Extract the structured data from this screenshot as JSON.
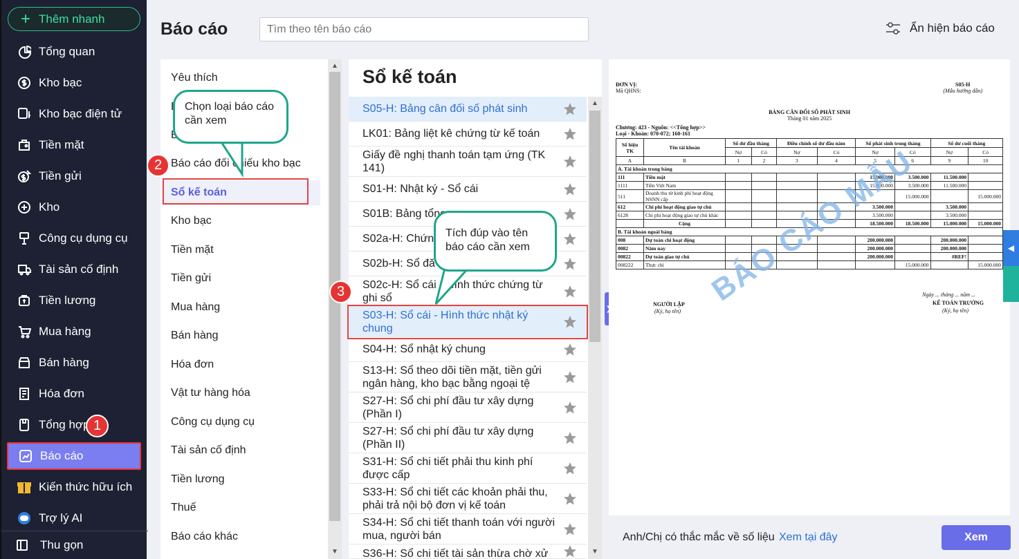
{
  "sidebar": {
    "add_label": "Thêm nhanh",
    "items": [
      {
        "label": "Tổng quan",
        "icon": "pie-chart-icon"
      },
      {
        "label": "Kho bạc",
        "icon": "dollar-circle-icon"
      },
      {
        "label": "Kho bạc điện tử",
        "icon": "dollar-screen-icon"
      },
      {
        "label": "Tiền mặt",
        "icon": "wallet-icon"
      },
      {
        "label": "Tiền gửi",
        "icon": "coin-arrow-icon"
      },
      {
        "label": "Kho",
        "icon": "warehouse-icon"
      },
      {
        "label": "Công cụ dụng cụ",
        "icon": "tool-icon"
      },
      {
        "label": "Tài sản cố định",
        "icon": "truck-icon"
      },
      {
        "label": "Tiền lương",
        "icon": "salary-icon"
      },
      {
        "label": "Mua hàng",
        "icon": "cart-icon"
      },
      {
        "label": "Bán hàng",
        "icon": "store-icon"
      },
      {
        "label": "Hóa đơn",
        "icon": "invoice-icon"
      },
      {
        "label": "Tổng hợp",
        "icon": "summary-icon"
      },
      {
        "label": "Báo cáo",
        "icon": "report-chart-icon"
      },
      {
        "label": "Kiến thức hữu ích",
        "icon": "gift-icon"
      },
      {
        "label": "Trợ lý AI",
        "icon": "robot-icon"
      }
    ],
    "collapse_label": "Thu gọn"
  },
  "header": {
    "title": "Báo cáo",
    "search_placeholder": "Tìm theo tên báo cáo",
    "toggle_label": "Ẩn hiện báo cáo"
  },
  "categories": [
    "Yêu thích",
    "B",
    "B",
    "Báo cáo đối chiếu kho bạc",
    "Sổ kế toán",
    "Kho bạc",
    "Tiền mặt",
    "Tiền gửi",
    "Mua hàng",
    "Bán hàng",
    "Hóa đơn",
    "Vật tư hàng hóa",
    "Công cụ dụng cụ",
    "Tài sản cố định",
    "Tiền lương",
    "Thuế",
    "Báo cáo khác"
  ],
  "reports_title": "Sổ kế toán",
  "reports": [
    "S05-H: Bảng cân đối số phát sinh",
    "LK01: Bảng liệt kê chứng từ kế toán",
    "Giấy đề nghị thanh toán tạm ứng (TK 141)",
    "S01-H: Nhật ký - Sổ cái",
    "S01B: Bảng tổng",
    "S02a-H: Chứn",
    "S02b-H: Sổ đă",
    "S02c-H: Sổ cái - Hình thức chứng từ ghi sổ",
    "S03-H: Sổ cái - Hình thức nhật ký chung",
    "S04-H: Sổ nhật ký chung",
    "S13-H: Sổ theo dõi tiền mặt, tiền gửi ngân hàng, kho bạc bằng ngoại tệ",
    "S27-H: Sổ chi phí đầu tư xây dựng (Phần I)",
    "S27-H: Sổ chi phí đầu tư xây dựng (Phần II)",
    "S31-H: Sổ chi tiết phải thu kinh phí được cấp",
    "S33-H: Sổ chi tiết các khoản phải thu, phải trả nội bộ đơn vị kế toán",
    "S34-H: Sổ chi tiết thanh toán với người mua, người bán",
    "S36-H: Sổ chi tiết tài sản thừa chờ xử lý"
  ],
  "callouts": {
    "c1": "Chọn loại báo cáo cần xem",
    "c2": "Tích đúp vào tên báo cáo cần xem"
  },
  "badges": {
    "b1": "1",
    "b2": "2",
    "b3": "3"
  },
  "preview": {
    "unit_label": "ĐƠN VỊ:",
    "qhns_label": "Mã QHNS:",
    "form_code": "S05-H",
    "form_note": "(Mẫu hướng dẫn)",
    "doc_title": "BẢNG CÂN ĐỐI SỐ PHÁT SINH",
    "period": "Tháng 01 năm 2025",
    "chapter": "Chương: 423 - Nguồn: <<Tổng hợp>>",
    "type_line": "Loại - Khoản: 070-072; 160-161",
    "headers": [
      "Số hiệu TK",
      "Tên tài khoản",
      "Số dư đầu tháng",
      "Điều chỉnh số dư đầu năm",
      "Số phát sinh trong tháng",
      "Số dư cuối tháng"
    ],
    "sub_no": "Nợ",
    "sub_co": "Có",
    "letter_a": "A",
    "letter_b": "B",
    "nums": [
      "1",
      "2",
      "3",
      "4",
      "5",
      "6",
      "9",
      "10"
    ],
    "sec_a": "A. Tài khoản trong bảng",
    "sec_b": "B. Tài khoản ngoài bảng",
    "rows": [
      {
        "tk": "111",
        "name": "Tiền mặt",
        "v5": "15.000.000",
        "v6": "3.500.000",
        "v9": "11.500.000",
        "v10": "",
        "bold": true
      },
      {
        "tk": "1111",
        "name": "Tiền Việt Nam",
        "v5": "15.000.000",
        "v6": "3.500.000",
        "v9": "11.500.000",
        "v10": "",
        "bold": false
      },
      {
        "tk": "511",
        "name": "Doanh thu từ kinh phí hoạt động NSNN cấp",
        "v5": "",
        "v6": "15.000.000",
        "v9": "",
        "v10": "15.000.000",
        "bold": false
      },
      {
        "tk": "612",
        "name": "Chi phí hoạt động giao tự chủ",
        "v5": "3.500.000",
        "v6": "",
        "v9": "3.500.000",
        "v10": "",
        "bold": true
      },
      {
        "tk": "6128",
        "name": "Chi phí hoạt động giao tự chủ khác",
        "v5": "3.500.000",
        "v6": "",
        "v9": "3.500.000",
        "v10": "",
        "bold": false
      },
      {
        "tk": "",
        "name": "Cộng",
        "v5": "18.500.000",
        "v6": "18.500.000",
        "v9": "15.000.000",
        "v10": "15.000.000",
        "bold": true
      }
    ],
    "rows_b": [
      {
        "tk": "008",
        "name": "Dự toán chi hoạt động",
        "v5": "200.000.000",
        "v6": "",
        "v9": "200.000.000",
        "v10": "",
        "bold": true
      },
      {
        "tk": "0082",
        "name": "Năm nay",
        "v5": "200.000.000",
        "v6": "",
        "v9": "200.000.000",
        "v10": "",
        "bold": true
      },
      {
        "tk": "00822",
        "name": "Dự toán giao tự chủ",
        "v5": "200.000.000",
        "v6": "",
        "v9": "#REF!",
        "v10": "",
        "bold": true
      },
      {
        "tk": "008222",
        "name": "Thực chi",
        "v5": "",
        "v6": "15.000.000",
        "v9": "",
        "v10": "15.000.000",
        "bold": false
      }
    ],
    "date_line": "Ngày ... tháng ... năm ...",
    "signer1": "NGƯỜI LẬP",
    "signer2": "KẾ TOÁN TRƯỞNG",
    "sign_note": "(Ký, họ tên)",
    "watermark": "BÁO CÁO MẪU"
  },
  "footer": {
    "question": "Anh/Chị có thắc mắc về số liệu",
    "link": "Xem tại đây",
    "view_button": "Xem"
  }
}
